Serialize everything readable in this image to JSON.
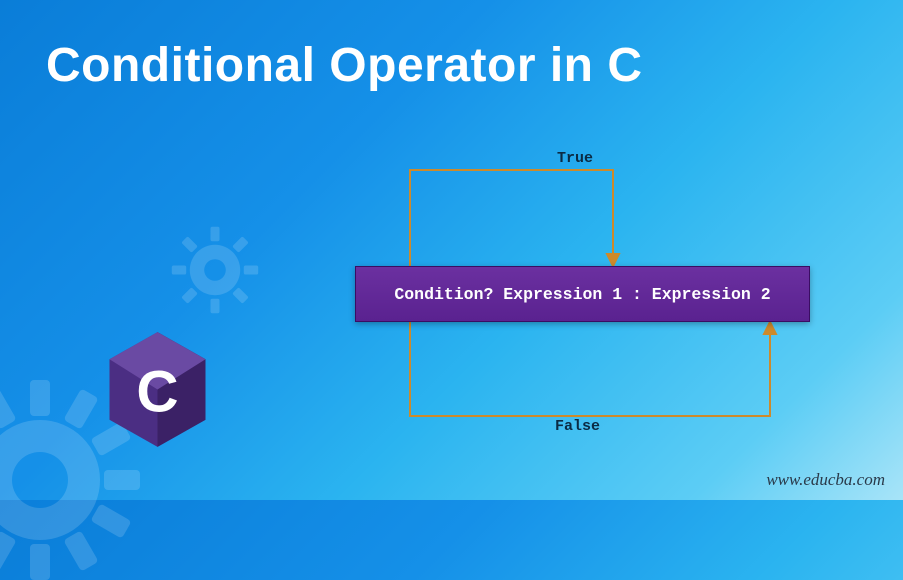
{
  "title": "Conditional Operator in C",
  "diagram": {
    "trueLabel": "True",
    "falseLabel": "False",
    "expression": "Condition? Expression 1 : Expression 2"
  },
  "watermark": "www.educba.com",
  "logo": {
    "letter": "C"
  },
  "colors": {
    "accentLine": "#cd8a2b",
    "box": "#5a2290",
    "text": "#ffffff"
  }
}
